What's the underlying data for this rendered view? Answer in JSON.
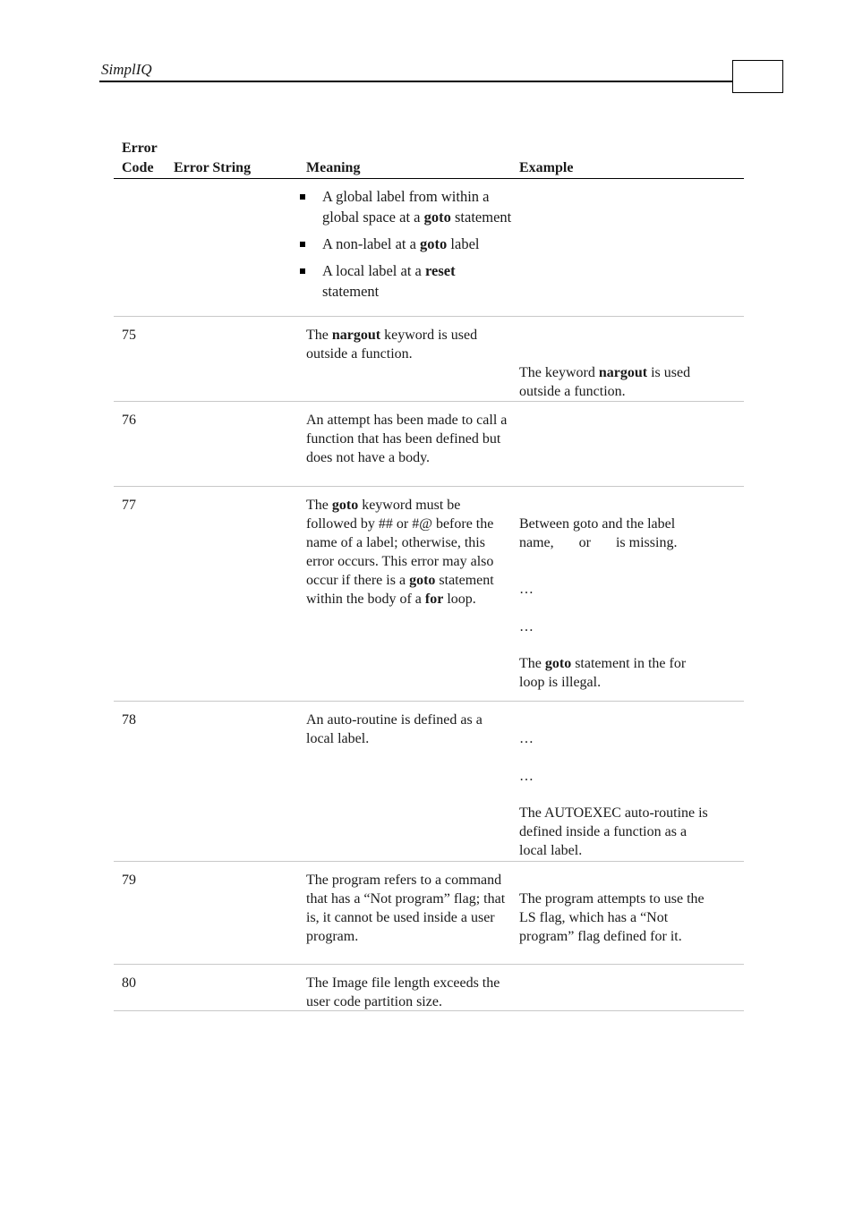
{
  "header": {
    "title": "SimplIQ",
    "page_number": ""
  },
  "table": {
    "columns": {
      "code_line1": "Error",
      "code_line2": "Code",
      "string": "Error String",
      "meaning": "Meaning",
      "example": "Example"
    },
    "continuation": {
      "bullets": [
        [
          {
            "t": "A global label from within a global space at a "
          },
          {
            "t": "goto",
            "b": true
          },
          {
            "t": " statement"
          }
        ],
        [
          {
            "t": "A non-label at a "
          },
          {
            "t": "goto",
            "b": true
          },
          {
            "t": " label"
          }
        ],
        [
          {
            "t": "A local label at a "
          },
          {
            "t": "reset",
            "b": true
          },
          {
            "t": " statement"
          }
        ]
      ]
    },
    "rows": [
      {
        "code": "75",
        "meaning": [
          {
            "t": "The "
          },
          {
            "t": "nargout",
            "b": true
          },
          {
            "t": " keyword is used outside a function."
          }
        ],
        "example": [
          [
            {
              "t": "The keyword "
            },
            {
              "t": "nargout",
              "b": true
            },
            {
              "t": " is used"
            }
          ],
          [
            {
              "t": "outside a function."
            }
          ]
        ]
      },
      {
        "code": "76",
        "meaning": [
          {
            "t": "An attempt has been made to call a function that has been defined but does not have a body."
          }
        ],
        "example": []
      },
      {
        "code": "77",
        "meaning": [
          {
            "t": "The "
          },
          {
            "t": "goto",
            "b": true
          },
          {
            "t": " keyword must be followed by ## or #@ before the name of a label; otherwise, this error occurs. This error may also occur if there is a "
          },
          {
            "t": "goto",
            "b": true
          },
          {
            "t": " statement within the body of a "
          },
          {
            "t": "for",
            "b": true
          },
          {
            "t": " loop."
          }
        ],
        "example": [
          [
            {
              "t": "Between goto and the label"
            }
          ],
          [
            {
              "t": "name,       or       is missing."
            }
          ],
          [
            {
              "t": "…"
            }
          ],
          [
            {
              "t": "…"
            }
          ],
          [
            {
              "t": "The "
            },
            {
              "t": "goto",
              "b": true
            },
            {
              "t": " statement in the for"
            }
          ],
          [
            {
              "t": "loop is illegal."
            }
          ]
        ]
      },
      {
        "code": "78",
        "meaning": [
          {
            "t": "An auto-routine is defined as a local label."
          }
        ],
        "example": [
          [
            {
              "t": "…"
            }
          ],
          [
            {
              "t": "…"
            }
          ],
          [
            {
              "t": "The AUTOEXEC auto-routine is"
            }
          ],
          [
            {
              "t": "defined inside a function as a"
            }
          ],
          [
            {
              "t": "local label."
            }
          ]
        ]
      },
      {
        "code": "79",
        "meaning": [
          {
            "t": "The program refers to a command that has a “Not program” flag; that is, it cannot be used inside a user program."
          }
        ],
        "example": [
          [
            {
              "t": "The program attempts to use the"
            }
          ],
          [
            {
              "t": "LS flag, which has a “Not"
            }
          ],
          [
            {
              "t": "program” flag defined for it."
            }
          ]
        ]
      },
      {
        "code": "80",
        "meaning": [
          {
            "t": "The Image file length exceeds the user code partition size."
          }
        ],
        "example": []
      }
    ]
  }
}
